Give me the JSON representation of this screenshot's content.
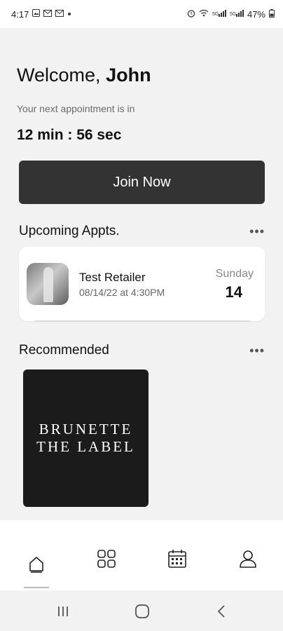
{
  "status_bar": {
    "time": "4:17",
    "battery": "47%",
    "left_icons": [
      "image-icon",
      "mail-icon",
      "mail-icon",
      "dot-icon"
    ],
    "right_icons": [
      "alarm-icon",
      "wifi-icon",
      "signal-icon",
      "signal-icon",
      "battery-icon"
    ]
  },
  "header": {
    "greeting": "Welcome,",
    "user_name": "John",
    "next_label": "Your next appointment is in",
    "countdown": "12 min : 56 sec"
  },
  "join_button": {
    "label": "Join Now"
  },
  "upcoming": {
    "title": "Upcoming Appts.",
    "more": "•••",
    "appointment": {
      "name": "Test Retailer",
      "time": "08/14/22 at 4:30PM",
      "day": "Sunday",
      "date": "14"
    }
  },
  "recommended": {
    "title": "Recommended",
    "more": "•••",
    "items": [
      {
        "line1": "BRUNETTE",
        "line2": "THE LABEL"
      }
    ]
  },
  "bottom_nav": {
    "items": [
      {
        "icon": "home-icon",
        "active": true
      },
      {
        "icon": "grid-icon",
        "active": false
      },
      {
        "icon": "calendar-icon",
        "active": false
      },
      {
        "icon": "profile-icon",
        "active": false
      }
    ]
  },
  "colors": {
    "background": "#f2f2f2",
    "button": "#333333",
    "card": "#ffffff",
    "rec_card": "#1b1b1b"
  }
}
